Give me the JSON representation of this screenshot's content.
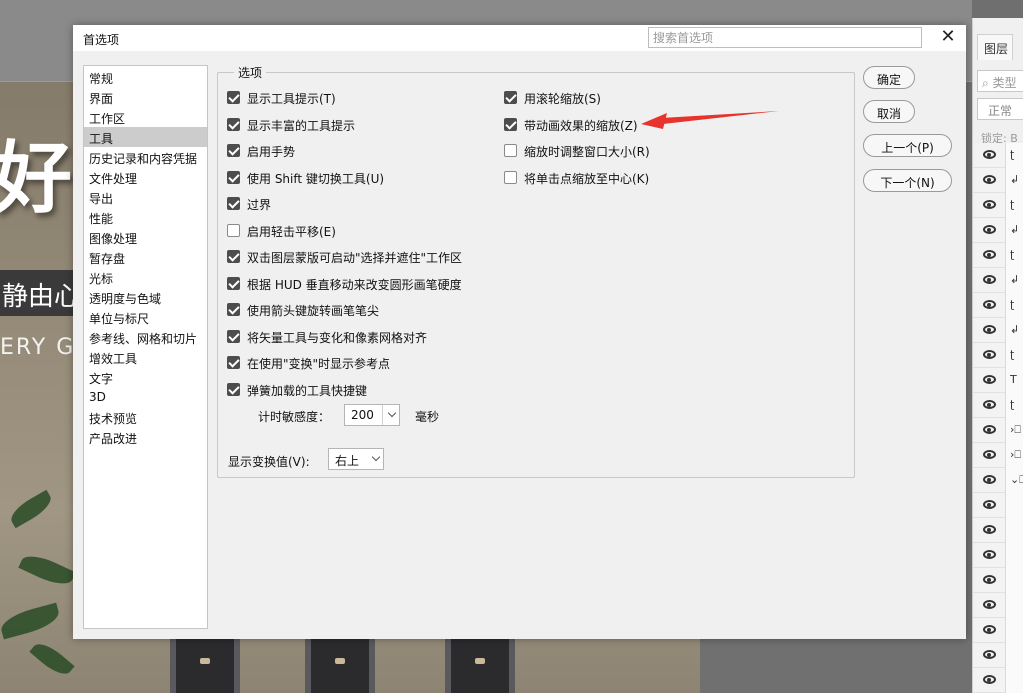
{
  "canvas": {
    "big_char": "好",
    "sub_text": "静由心",
    "eng_text": "ERY G"
  },
  "layers_panel": {
    "tab_label": "图层",
    "search_placeholder": "类型",
    "blend_mode": "正常",
    "lock_label": "锁定: B",
    "row_thumbs": [
      "ʈ",
      "↲",
      "ʈ",
      "↲",
      "ʈ",
      "↲",
      "ʈ",
      "↲",
      "ʈ",
      "T",
      "ʈ",
      "›⎕",
      "›⎕",
      "⌄⎕",
      "",
      "",
      "",
      "",
      "",
      "",
      "",
      ""
    ]
  },
  "dialog": {
    "title": "首选项",
    "search_placeholder": "搜索首选项",
    "close_glyph": "✕",
    "nav_items": [
      "常规",
      "界面",
      "工作区",
      "工具",
      "历史记录和内容凭据",
      "文件处理",
      "导出",
      "性能",
      "图像处理",
      "暂存盘",
      "光标",
      "透明度与色域",
      "单位与标尺",
      "参考线、网格和切片",
      "增效工具",
      "文字",
      "3D",
      "技术预览",
      "产品改进"
    ],
    "selected_nav": "工具",
    "group_label": "选项",
    "left_options": [
      {
        "label": "显示工具提示(T)",
        "checked": true
      },
      {
        "label": "显示丰富的工具提示",
        "checked": true
      },
      {
        "label": "启用手势",
        "checked": true
      },
      {
        "label": "使用 Shift 键切换工具(U)",
        "checked": true
      },
      {
        "label": "过界",
        "checked": true
      },
      {
        "label": "启用轻击平移(E)",
        "checked": false
      },
      {
        "label": "双击图层蒙版可启动\"选择并遮住\"工作区",
        "checked": true
      },
      {
        "label": "根据 HUD 垂直移动来改变圆形画笔硬度",
        "checked": true
      },
      {
        "label": "使用箭头键旋转画笔笔尖",
        "checked": true
      },
      {
        "label": "将矢量工具与变化和像素网格对齐",
        "checked": true
      },
      {
        "label": "在使用\"变换\"时显示参考点",
        "checked": true
      },
      {
        "label": "弹簧加载的工具快捷键",
        "checked": true
      }
    ],
    "right_options": [
      {
        "label": "用滚轮缩放(S)",
        "checked": true
      },
      {
        "label": "带动画效果的缩放(Z)",
        "checked": true
      },
      {
        "label": "缩放时调整窗口大小(R)",
        "checked": false
      },
      {
        "label": "将单击点缩放至中心(K)",
        "checked": false
      }
    ],
    "timer_label": "计时敏感度：",
    "timer_value": "200",
    "timer_unit": "毫秒",
    "transform_label": "显示变换值(V):",
    "transform_value": "右上",
    "buttons": {
      "ok": "确定",
      "cancel": "取消",
      "prev": "上一个(P)",
      "next": "下一个(N)"
    },
    "annotation_arrow_color": "#e8322c"
  }
}
